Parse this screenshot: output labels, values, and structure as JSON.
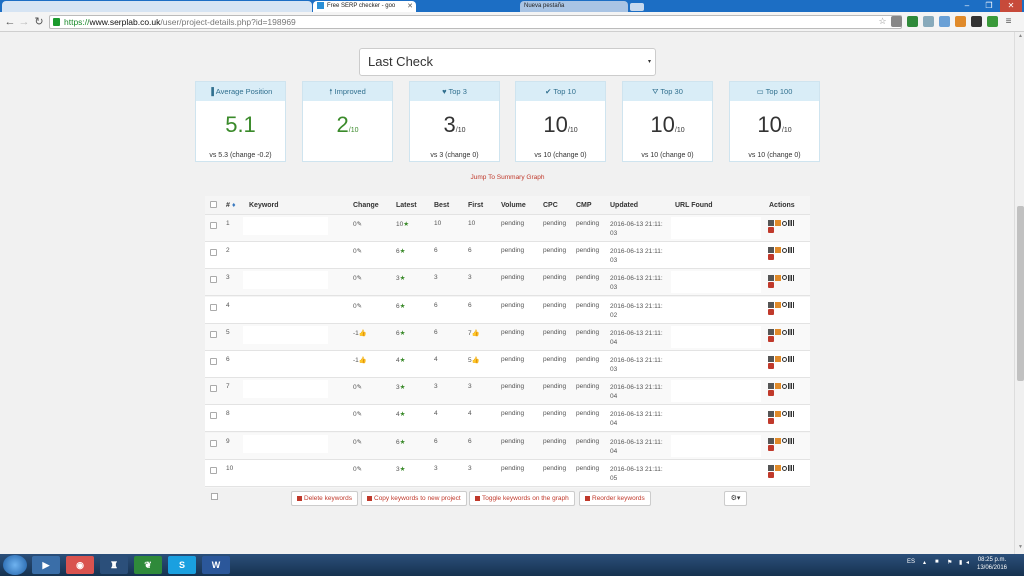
{
  "browser": {
    "tabs": [
      {
        "title": ""
      },
      {
        "title": "Free SERP checker - goo"
      },
      {
        "title": "Nueva pestaña"
      }
    ],
    "url": {
      "proto": "https://",
      "host": "www.serplab.co.uk",
      "path": "/user/project-details.php?id=198969"
    },
    "window_controls": [
      "–",
      "❐",
      "✕"
    ]
  },
  "period_select": {
    "value": "Last Check",
    "caret": "▾"
  },
  "summary_cards": [
    {
      "icon": "bar-chart-icon",
      "glyph": "▐",
      "label": "Average Position",
      "value": "5.1",
      "denom": "",
      "vs": "vs 5.3 (change -0.2)",
      "color": "#3a8a2a"
    },
    {
      "icon": "arrow-up-icon",
      "glyph": "🠕",
      "label": "Improved",
      "value": "2",
      "denom": "/10",
      "vs": "",
      "color": "#3a8a2a"
    },
    {
      "icon": "heart-icon",
      "glyph": "♥",
      "label": "Top 3",
      "value": "3",
      "denom": "/10",
      "vs": "vs 3 (change 0)",
      "color": "#333333"
    },
    {
      "icon": "check-icon",
      "glyph": "✔",
      "label": "Top 10",
      "value": "10",
      "denom": "/10",
      "vs": "vs 10 (change 0)",
      "color": "#333333"
    },
    {
      "icon": "road-icon",
      "glyph": "⛛",
      "label": "Top 30",
      "value": "10",
      "denom": "/10",
      "vs": "vs 10 (change 0)",
      "color": "#333333"
    },
    {
      "icon": "briefcase-icon",
      "glyph": "▭",
      "label": "Top 100",
      "value": "10",
      "denom": "/10",
      "vs": "vs 10 (change 0)",
      "color": "#333333"
    }
  ],
  "jump_link": "Jump To Summary Graph",
  "table": {
    "headers": {
      "num": "#",
      "keyword": "Keyword",
      "change": "Change",
      "latest": "Latest",
      "best": "Best",
      "first": "First",
      "volume": "Volume",
      "cpc": "CPC",
      "cmp": "CMP",
      "updated": "Updated",
      "url": "URL Found",
      "actions": "Actions"
    },
    "rows": [
      {
        "num": "1",
        "change": "0",
        "change_icon": "pin",
        "latest": "10",
        "best": "10",
        "first": "10",
        "first_icon": "",
        "volume": "pending",
        "cpc": "pending",
        "cmp": "pending",
        "updated_1": "2016-06-13 21:11:",
        "updated_2": "03"
      },
      {
        "num": "2",
        "change": "0",
        "change_icon": "pin",
        "latest": "6",
        "best": "6",
        "first": "6",
        "first_icon": "",
        "volume": "pending",
        "cpc": "pending",
        "cmp": "pending",
        "updated_1": "2016-06-13 21:11:",
        "updated_2": "03"
      },
      {
        "num": "3",
        "change": "0",
        "change_icon": "pin",
        "latest": "3",
        "best": "3",
        "first": "3",
        "first_icon": "",
        "volume": "pending",
        "cpc": "pending",
        "cmp": "pending",
        "updated_1": "2016-06-13 21:11:",
        "updated_2": "03"
      },
      {
        "num": "4",
        "change": "0",
        "change_icon": "pin",
        "latest": "6",
        "best": "6",
        "first": "6",
        "first_icon": "",
        "volume": "pending",
        "cpc": "pending",
        "cmp": "pending",
        "updated_1": "2016-06-13 21:11:",
        "updated_2": "02"
      },
      {
        "num": "5",
        "change": "-1",
        "change_icon": "thumb",
        "latest": "6",
        "best": "6",
        "first": "7",
        "first_icon": "thumb",
        "volume": "pending",
        "cpc": "pending",
        "cmp": "pending",
        "updated_1": "2016-06-13 21:11:",
        "updated_2": "04"
      },
      {
        "num": "6",
        "change": "-1",
        "change_icon": "thumb",
        "latest": "4",
        "best": "4",
        "first": "5",
        "first_icon": "thumb",
        "volume": "pending",
        "cpc": "pending",
        "cmp": "pending",
        "updated_1": "2016-06-13 21:11:",
        "updated_2": "03"
      },
      {
        "num": "7",
        "change": "0",
        "change_icon": "pin",
        "latest": "3",
        "best": "3",
        "first": "3",
        "first_icon": "",
        "volume": "pending",
        "cpc": "pending",
        "cmp": "pending",
        "updated_1": "2016-06-13 21:11:",
        "updated_2": "04"
      },
      {
        "num": "8",
        "change": "0",
        "change_icon": "pin",
        "latest": "4",
        "best": "4",
        "first": "4",
        "first_icon": "",
        "volume": "pending",
        "cpc": "pending",
        "cmp": "pending",
        "updated_1": "2016-06-13 21:11:",
        "updated_2": "04"
      },
      {
        "num": "9",
        "change": "0",
        "change_icon": "pin",
        "latest": "6",
        "best": "6",
        "first": "6",
        "first_icon": "",
        "volume": "pending",
        "cpc": "pending",
        "cmp": "pending",
        "updated_1": "2016-06-13 21:11:",
        "updated_2": "04"
      },
      {
        "num": "10",
        "change": "0",
        "change_icon": "pin",
        "latest": "3",
        "best": "3",
        "first": "3",
        "first_icon": "",
        "volume": "pending",
        "cpc": "pending",
        "cmp": "pending",
        "updated_1": "2016-06-13 21:11:",
        "updated_2": "05"
      }
    ]
  },
  "buttons": {
    "delete": "Delete keywords",
    "copy": "Copy keywords to new project",
    "toggle": "Toggle keywords on the graph",
    "reorder": "Reorder keywords",
    "gear": "⚙▾"
  },
  "taskbar": {
    "apps": [
      {
        "icon": "media-player-icon",
        "glyph": "▶",
        "color": "#3a6ea8"
      },
      {
        "icon": "chrome-icon",
        "glyph": "◉",
        "color": "#d9534f"
      },
      {
        "icon": "tool-icon",
        "glyph": "♜",
        "color": "#2b4f7a"
      },
      {
        "icon": "evernote-icon",
        "glyph": "❦",
        "color": "#2f8a3a"
      },
      {
        "icon": "skype-icon",
        "glyph": "S",
        "color": "#1aa0e0"
      },
      {
        "icon": "word-icon",
        "glyph": "W",
        "color": "#2b579a"
      }
    ],
    "lang": "ES",
    "time": "08:25 p.m.",
    "date": "13/06/2016"
  },
  "colors": {
    "accent": "#c0392b",
    "card_header": "#d9edf7",
    "green": "#3a8a2a"
  }
}
